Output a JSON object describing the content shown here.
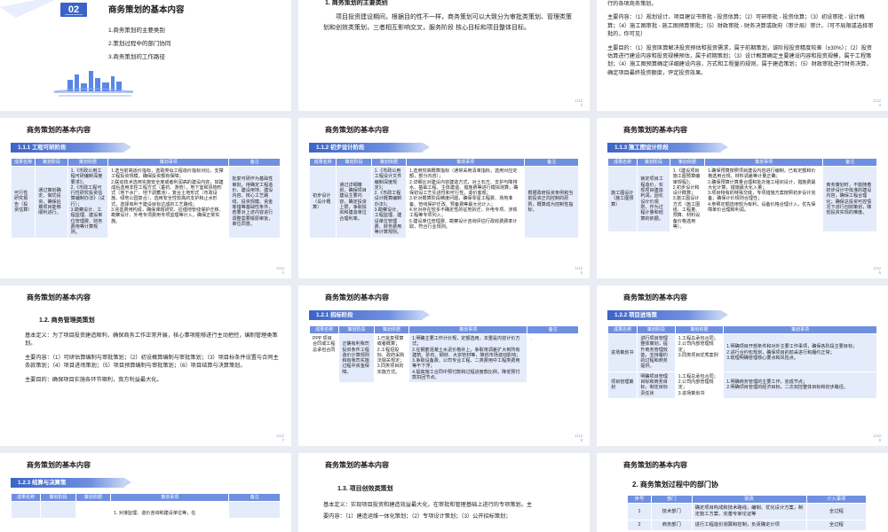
{
  "common": {
    "deck_title": "商务策划的基本内容",
    "cols_a": [
      "成果名称",
      "策划阶段",
      "策划依据",
      "策划事项",
      "备注"
    ],
    "cols_b": [
      "成果名称",
      "策划阶段",
      "策划依据",
      "策划事项",
      "备注"
    ]
  },
  "s1": {
    "number": "02",
    "title": "商务策划的基本内容",
    "items": [
      "1.商务策划的主要类别",
      "2.策划过程中的部门协同",
      "3.商务策划的工作路径"
    ]
  },
  "s2": {
    "heading": "1. 商务策划的主要类别",
    "para": "项目投资建设期间，根据目的性不一样，商务策划可以大致分为审批类策划、管理类策划和创效类策划，三者相互影响交叉，服务阶段 核心目标和项目整体目标。",
    "page": "1/12\n2"
  },
  "s3": {
    "lead": "行的各项商务策划。",
    "p1": "主要内容：（1）规划设计、项目建议书审批 - 投资估算；（2）可研审批 - 投资估算；（3）初设审批 - 设计概算；（4）施工图审批 - 施工图预算审批；（5）财政审批 - 财务决算或政府（审计局）审计。（可不局限或选择审批的，你可见）",
    "p2": "主要目的：（1）投资匡算解决投资预估和投资需求，属于前期策划，该阶段投资精度较差（±30%）；（2）投资估算进行建设内容和投资规模预估，属于初期策划；（3）设计概算确定主要建设内容和投资规模，属于工程策划；（4）施工图预算确定详细建设内容，方式和工程量的规则，属于建造策划；（5）财政审批进行财务决算，确定项目最终投资额度，评定投资效果。",
    "page": "1/12\n3"
  },
  "s4": {
    "banner": "1.1.1  工程可研阶段",
    "row": {
      "name": "可行性研究报告（投资估算）",
      "stage": "通过策划确定、做优投资，确保后期项目能够顺利进行。",
      "basis": "1.《市政公用工程可研编制深度要求》；\n2.《市政工程可行性研究投资估算编制办法》（试行）；\n3.勘察设计、工程监理、建设单位管理费、财务费用等计算规则。",
      "items": "1.选当前高适价指标，选取类似工程造价指标对比，支撑工程投资规模，确保投资额有保障；\n2.联动技术选用实施安全度或者利润高的建设内容，如建成后选用非控工程方式（垂钓、游管），地下室和风物形式（地下水厂、地下调蓄池），复合土地形式（市政设施、绿地公园复合），选用安全性较高的支护和止水形式，选择有利于建设目标达成的工艺路线；\n3.完善费用构成，确保课题研究、征借地管线保护迁移、勘察设计、外电专项费用专项监理等计入，确保正常实施。",
      "note": "批复可研作为基础性审批，待确定工程造价、建设用地、建设内容、核心工艺路线、投资规模、资金筹措等基础性条件，若要对上述内容进行调整需要报原审批，单位同意。"
    },
    "page": "1/12\n4"
  },
  "s5": {
    "banner": "1.1.2  初步设计阶段",
    "row": {
      "name": "初步设计（设计概算）",
      "stage": "通过详细策划，确保项目建设主要内容，确定投资上限，争取投资和建造单位合理利率。",
      "basis": "1.《市政公用工程设计文件编制深度规定》；\n2.《市政工程设计概算编制办法》；\n3.勘察设计、工程监理、建设单位管理费、财务费用等计算规则。",
      "items": "1.选用较高概算指标（通常采用清单指标，选用对应定额，部分内容）；\n2.详细比对建设内容建造方式，对土石方、支护与降排水、基础工程、主体建造、措施费等进行模拟测算，确保初设工艺先进性和可行性，造价客观；\n3.针对概算阶段精度问题，确保零星工程费、场地准备、管线保护迁改、预备费等最大化计入；\n4.针对存在较多不确定性的征地拆迁、外电专项、涉铁工程等专项列入；\n5.建设单位管理费、勘察设计咨询评估行政收费费率计取，符合行业规则。",
      "note": "根据政府投资条例和当前投资正向控制的原则，概算成为控制性指标。"
    },
    "page": "1/12\n5"
  },
  "s6": {
    "banner": "1.1.3  施工图设计阶段",
    "row": {
      "name": "施工图设计（施工图预算）",
      "stage": "锁定项目工程造价，实现项目建造利润，固化设计价观则，作为过程计量和结算的依据。",
      "basis": "1.《建设项目施工图预算编审规程》；\n2.初步设计和设计概算；\n3.施工图设计方式（施工图纸、工程量、预算、材料设备价格选用等）。",
      "items": "1.确保预算按照项目建设内容进行编制，已有定额和价格选用合规，材料调差等计量正确；\n2.确保预算计算量合理和批办施工组织设计，措施费最大化计算，措施最大化入量；\n3.项目特有的特殊交底，专项措施方案按照初步设计完备，确保计价规则合理性；\n4.参照定额选用较为有利，设备价格合理计入，优先保障单价合理和利润。",
      "note": "商务策划时，不能随着初步设计中批准的建设内容，确保工程合理化；确保总投资可控情况下进行创效策划，降低投资实现的难度。"
    },
    "page": "1/12\n6"
  },
  "s7": {
    "heading": "1.2. 商务管理类策划",
    "p1": "基本定义：为了项目投资建造顺利，确保商务工作正常开展，核心事项能够进行主动把控，编制管理类策划。",
    "p2": "主要内容：（1）可研估算编制与审批策划；（2）初设概算编制与审批策划；（3）项目标条件设置与合同主条款策划；（4）项目进场策划；（5）项目预算编制与审批策划；（6）项目结算与决算策划。",
    "p3": "主要目的：确保项目实施各环节顺利，我方利益最大化。",
    "page": "1/12\n7"
  },
  "s8": {
    "banner": "1.2.1  招标阶段",
    "row": {
      "name": "PPP 项目合同或工程总承包合同",
      "stage": "正确有利我司投资条件工程造价计算规则和有我司实施过程中资金保障。",
      "basis": "1.已批复预算或者概算；\n2.工程招投标、政府采购法相关规定；\n3.同类项目的实施方式。",
      "items": "1.明确主要工作计价规，定额选用，本重是内容计价方式；\n2.在钢筋混凝土水泥价格补上，争取将调差扩大到所有建筑、砂石、钢材、大宗管材等，降低市场波动影响；\n3.争取设备费、公司专业工程、二类费用中工程类费用等不下浮；\n4.提高施工合同中预付款和过程进度款比例，降低预付款扣回节点。",
      "note": "."
    },
    "page": "1/12\n8"
  },
  "s9": {
    "banner": "1.2.2  项目进场策",
    "row1": {
      "name": "进场策划书",
      "stage": "进行项目管理整体策划，提升商务管理效能，支持履约的过程和商务提供。",
      "basis": "1.工程总承包合同；\n2.公司内部管理规定；\n3.同类项目优秀案例",
      "items": "1.明确项目开部条件和对外主要工作事项，确保各阶段主要目标；\n2.进行合约包规划，确保项目的前采进行和履约正常；\n3.梳理明确管理核心要点和风险点。"
    },
    "row2": {
      "name": "项目管理策划",
      "stage": "明确项目管理目标和商务目标，制定目标责任状",
      "basis": "1.工程总承包合同；\n2.公司内部管理规定；\n3.进场策划书",
      "items": "1.明确商务管理的主要工作，完成节点；\n2.明确项目管理的经济目标，二次双控整体目标和初步路径。"
    },
    "page": "1/12\n9"
  },
  "s10": {
    "banner": "1.2.3  结算与决算策",
    "item": "1. 对接监理、造价咨询和建设单位等，在"
  },
  "s11": {
    "heading": "1.3. 项目创效类策划",
    "p1": "基本定义：实现项目投资和建造效益最大化，在审批和管理基础上进行的专项策划。主",
    "p2": "要内容：（1）建造运维一体化策划；（2）专项设计策划；（3）公开招标策划；"
  },
  "s12": {
    "heading": "2. 商务策划过程中的部门协",
    "cols": [
      "序号",
      "部门",
      "职责",
      "介入事项"
    ],
    "rows": [
      [
        "1",
        "技术部门",
        "确定项目构成和技术路线，编制、优化设计方案，制定施工方案、完善专家论证等",
        "全过程"
      ],
      [
        "2",
        "商务部门",
        "进行工程造价测算和控制，负责确定计项",
        "全过程"
      ]
    ]
  }
}
